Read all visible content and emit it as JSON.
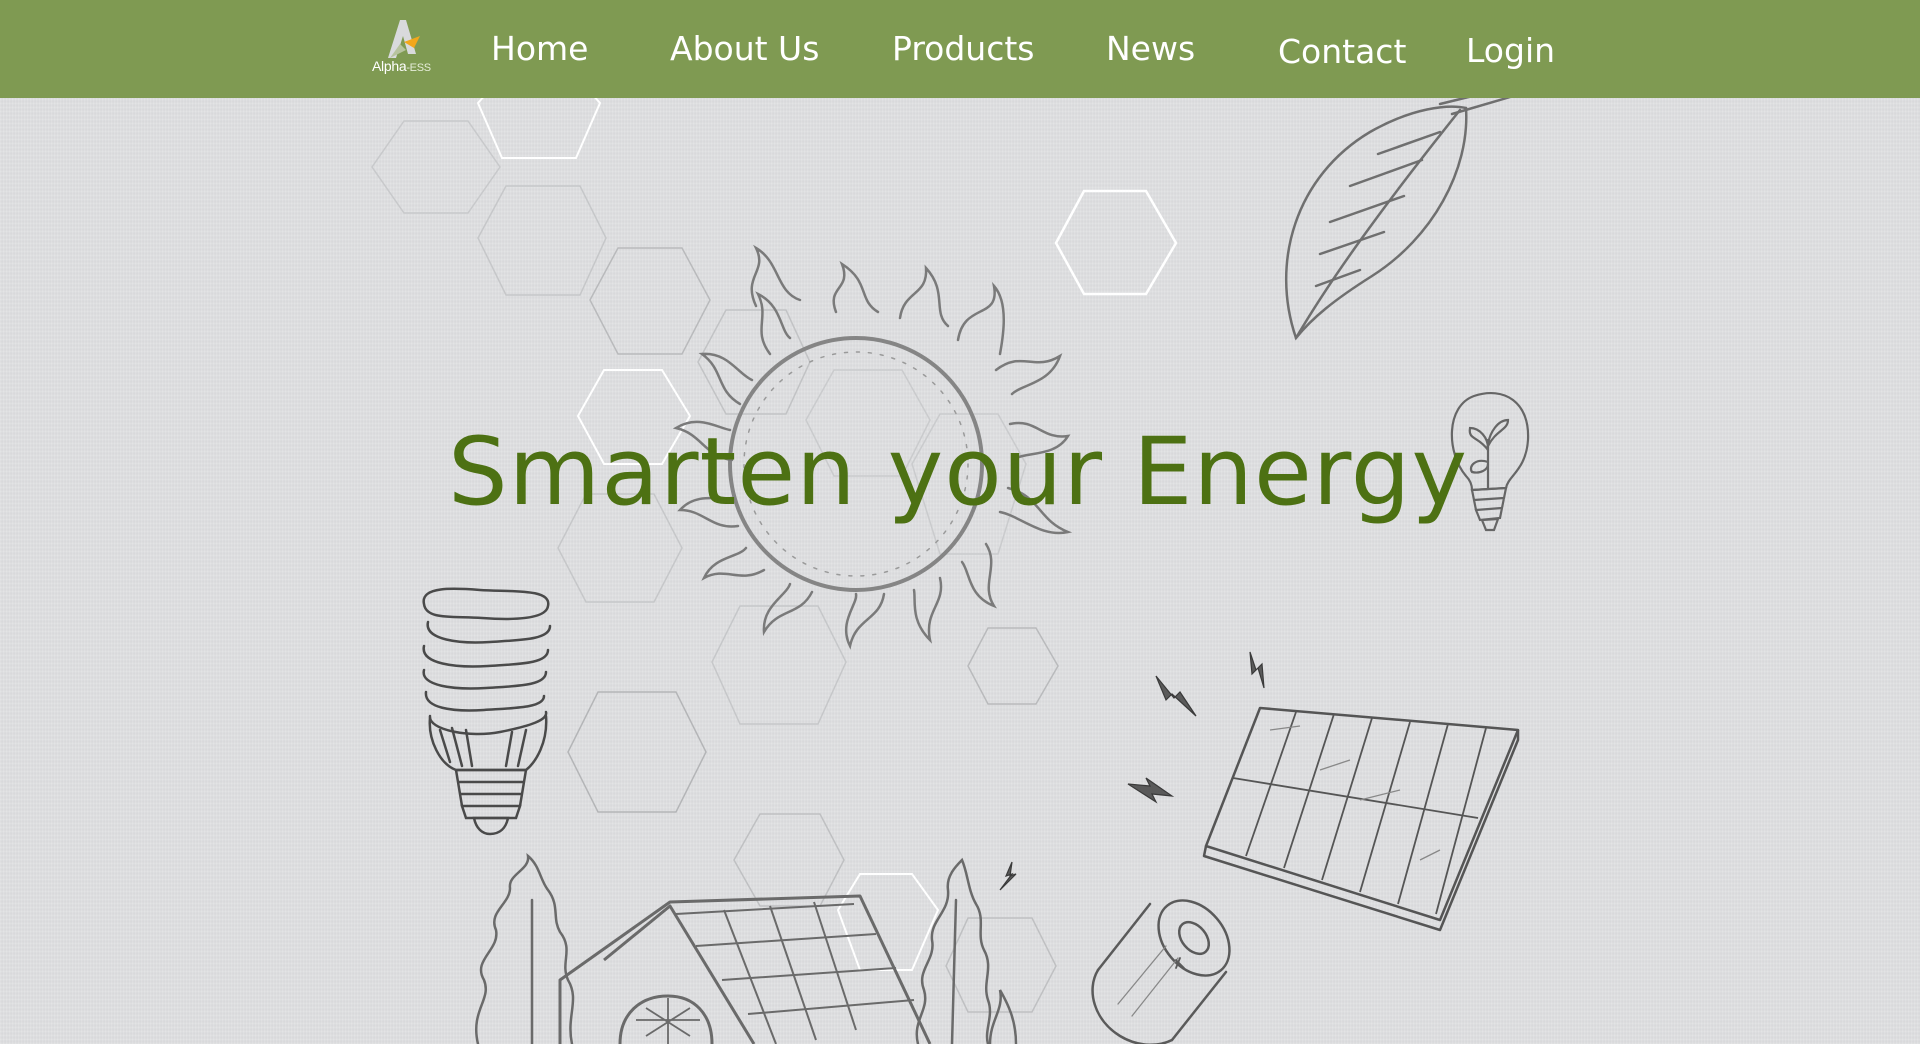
{
  "brand": {
    "logo_text": "Alpha",
    "logo_suffix": "-ESS",
    "nav_color": "#7f9a52",
    "accent_color": "#f2a71b",
    "title_color": "#4d7113"
  },
  "nav": {
    "items": [
      {
        "label": "Home"
      },
      {
        "label": "About Us"
      },
      {
        "label": "Products"
      },
      {
        "label": "News"
      },
      {
        "label": "Contact"
      },
      {
        "label": "Login"
      }
    ]
  },
  "hero": {
    "title_part1": "Smarten your",
    "title_part2": "Energy"
  },
  "illustrations": [
    "sun-sketch",
    "leaf-sketch",
    "eco-bulb-sketch",
    "cfl-bulb-sketch",
    "solar-panel-sketch",
    "battery-sketch",
    "house-with-solar-roof-sketch",
    "trees-sketch",
    "lightning-bolts-sketch",
    "hexagon-pattern"
  ]
}
